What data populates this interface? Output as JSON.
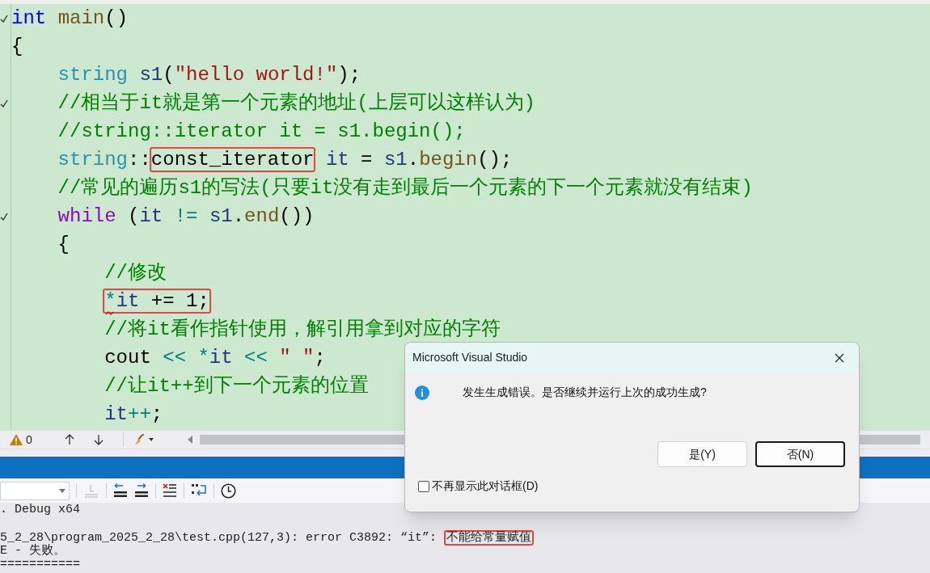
{
  "editor": {
    "lines": [
      {
        "kind": "line",
        "fold_mark": true,
        "tokens": [
          {
            "kind": "keyword",
            "text": "int"
          },
          {
            "kind": "function",
            "text": "main",
            "space_before": true
          },
          {
            "kind": "plain",
            "text": "()"
          }
        ]
      },
      {
        "kind": "line",
        "fold_mark": false,
        "tokens": [
          {
            "kind": "plain",
            "text": "{"
          }
        ]
      },
      {
        "kind": "block",
        "children": [
          {
            "kind": "line",
            "fold_mark": false,
            "tokens": [
              {
                "kind": "type",
                "text": "string"
              },
              {
                "kind": "variable",
                "text": "s1",
                "space_before": true
              },
              {
                "kind": "plain",
                "text": "("
              },
              {
                "kind": "string",
                "text": "\"hello world!\""
              },
              {
                "kind": "plain",
                "text": ");"
              }
            ]
          },
          {
            "kind": "line",
            "fold_mark": true,
            "tokens": [
              {
                "kind": "comment",
                "text": "//相当于it就是第一个元素的地址(上层可以这样认为)"
              }
            ]
          },
          {
            "kind": "line",
            "fold_mark": false,
            "tokens": [
              {
                "kind": "comment",
                "text": "//string::iterator it = s1.begin();"
              }
            ]
          },
          {
            "kind": "line",
            "fold_mark": false,
            "tokens": [
              {
                "kind": "type",
                "text": "string"
              },
              {
                "kind": "plain",
                "text": "::"
              },
              {
                "kind": "boxed",
                "tokens": [
                  {
                    "kind": "plain",
                    "text": "const_iterator"
                  }
                ]
              },
              {
                "kind": "variable",
                "text": "it",
                "space_before": true
              },
              {
                "kind": "plain",
                "text": "=",
                "space_before": true
              },
              {
                "kind": "variable",
                "text": "s1",
                "space_before": true
              },
              {
                "kind": "plain",
                "text": "."
              },
              {
                "kind": "function",
                "text": "begin"
              },
              {
                "kind": "plain",
                "text": "();"
              }
            ]
          },
          {
            "kind": "line",
            "fold_mark": false,
            "tokens": [
              {
                "kind": "comment",
                "text": "//常见的遍历s1的写法(只要it没有走到最后一个元素的下一个元素就没有结束)"
              }
            ]
          },
          {
            "kind": "line",
            "fold_mark": true,
            "tokens": [
              {
                "kind": "control",
                "text": "while"
              },
              {
                "kind": "plain",
                "text": "(",
                "space_before": true
              },
              {
                "kind": "variable",
                "text": "it"
              },
              {
                "kind": "operator",
                "text": "!=",
                "space_before": true
              },
              {
                "kind": "variable",
                "text": "s1",
                "space_before": true
              },
              {
                "kind": "plain",
                "text": "."
              },
              {
                "kind": "function",
                "text": "end"
              },
              {
                "kind": "plain",
                "text": "())"
              }
            ]
          },
          {
            "kind": "line",
            "fold_mark": false,
            "tokens": [
              {
                "kind": "plain",
                "text": "{"
              }
            ]
          },
          {
            "kind": "block",
            "children": [
              {
                "kind": "line",
                "fold_mark": false,
                "tokens": [
                  {
                    "kind": "comment",
                    "text": "//修改"
                  }
                ]
              },
              {
                "kind": "line",
                "fold_mark": false,
                "tokens": [
                  {
                    "kind": "boxed",
                    "tokens": [
                      {
                        "kind": "operator_error",
                        "text": "*"
                      },
                      {
                        "kind": "variable",
                        "text": "it"
                      },
                      {
                        "kind": "plain",
                        "text": "+=",
                        "space_before": true
                      },
                      {
                        "kind": "plain",
                        "text": "1;",
                        "space_before": true
                      }
                    ]
                  }
                ]
              },
              {
                "kind": "line",
                "fold_mark": false,
                "tokens": [
                  {
                    "kind": "comment",
                    "text": "//将it看作指针使用，解引用拿到对应的字符"
                  }
                ]
              },
              {
                "kind": "line",
                "fold_mark": false,
                "tokens": [
                  {
                    "kind": "plain",
                    "text": "cout"
                  },
                  {
                    "kind": "operator",
                    "text": "<<",
                    "space_before": true
                  },
                  {
                    "kind": "operator",
                    "text": "*",
                    "space_before": true
                  },
                  {
                    "kind": "variable",
                    "text": "it"
                  },
                  {
                    "kind": "operator",
                    "text": "<<",
                    "space_before": true
                  },
                  {
                    "kind": "string",
                    "text": "\" \"",
                    "space_before": true
                  },
                  {
                    "kind": "plain",
                    "text": ";"
                  }
                ]
              },
              {
                "kind": "line",
                "fold_mark": false,
                "tokens": [
                  {
                    "kind": "comment",
                    "text": "//让it++到下一个元素的位置"
                  }
                ]
              },
              {
                "kind": "line",
                "fold_mark": false,
                "tokens": [
                  {
                    "kind": "variable",
                    "text": "it"
                  },
                  {
                    "kind": "operator",
                    "text": "++"
                  },
                  {
                    "kind": "plain",
                    "text": ";"
                  }
                ]
              }
            ]
          }
        ]
      }
    ]
  },
  "editor_status": {
    "warnings": "0"
  },
  "output": {
    "lines": [
      {
        "segments": [
          {
            "kind": "plain",
            "text": ". Debug x64"
          }
        ]
      },
      {
        "blank_line_before": true,
        "segments": [
          {
            "kind": "plain",
            "text": "5_2_28\\program_2025_2_28\\test.cpp(127,3): error C3892: “it”:"
          },
          {
            "kind": "boxed",
            "text": "不能给常量赋值",
            "space_before": true
          }
        ]
      },
      {
        "segments": [
          {
            "kind": "plain",
            "text": "E - 失败。"
          }
        ]
      },
      {
        "segments": [
          {
            "kind": "plain",
            "text": "==========="
          }
        ]
      }
    ]
  },
  "dialog": {
    "title": "Microsoft Visual Studio",
    "message": "发生生成错误。是否继续并运行上次的成功生成?",
    "buttons": [
      {
        "label": "是(Y)",
        "default": false
      },
      {
        "label": "否(N)",
        "default": true
      }
    ],
    "checkbox": {
      "label": "不再显示此对话框(D)",
      "checked": false
    }
  }
}
